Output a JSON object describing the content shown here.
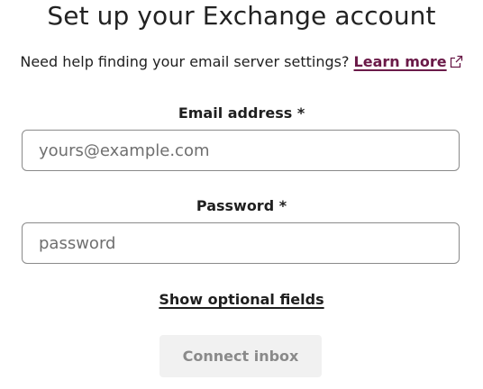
{
  "title": "Set up your Exchange account",
  "help": {
    "text": "Need help finding your email server settings?",
    "link_label": "Learn more",
    "icon": "external-link-icon"
  },
  "email_field": {
    "label": "Email address *",
    "placeholder": "yours@example.com",
    "value": ""
  },
  "password_field": {
    "label": "Password *",
    "placeholder": "password",
    "value": ""
  },
  "optional_fields_label": "Show optional fields",
  "connect_button": {
    "label": "Connect inbox",
    "state": "disabled"
  },
  "colors": {
    "link": "#6a1a48",
    "button_bg": "#f1f1f1",
    "button_text": "#8a8a8a",
    "input_border": "#8a8a8a"
  }
}
